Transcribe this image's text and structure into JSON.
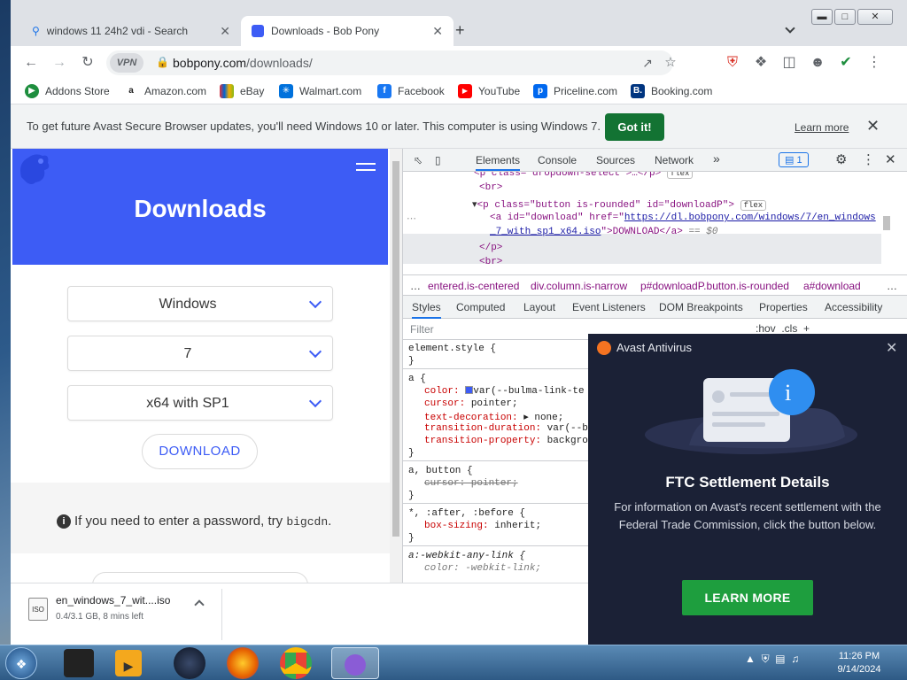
{
  "browser": {
    "tabs": [
      {
        "title": "windows 11 24h2 vdi - Search",
        "icon": "search-icon"
      },
      {
        "title": "Downloads - Bob Pony",
        "icon": "bobpony-favicon"
      }
    ],
    "new_tab_symbol": "+",
    "url_prefix": "bobpony.com",
    "url_path": "/downloads/",
    "vpn_label": "VPN",
    "bookmarks": [
      {
        "label": "Addons Store",
        "color": "#1e8e3e"
      },
      {
        "label": "Amazon.com",
        "color": "#222222"
      },
      {
        "label": "eBay",
        "color": "#e53238"
      },
      {
        "label": "Walmart.com",
        "color": "#0071dc"
      },
      {
        "label": "Facebook",
        "color": "#1877f2"
      },
      {
        "label": "YouTube",
        "color": "#ff0000"
      },
      {
        "label": "Priceline.com",
        "color": "#0068ef"
      },
      {
        "label": "Booking.com",
        "color": "#003580"
      }
    ]
  },
  "infobar": {
    "text": "To get future Avast Secure Browser updates, you'll need Windows 10 or later. This computer is using Windows 7.",
    "button": "Got it!",
    "link": "Learn more"
  },
  "page": {
    "title": "Downloads",
    "os_select": "Windows",
    "version_select": "7",
    "edition_select": "x64 with SP1",
    "download_button": "DOWNLOAD",
    "password_note": "If you need to enter a password, try",
    "password_code": "bigcdn",
    "password_end": ".",
    "accent_color": "#3d5cf5"
  },
  "devtools": {
    "tabs": [
      "Elements",
      "Console",
      "Sources",
      "Network"
    ],
    "more_tabs": "»",
    "issues_count": "1",
    "dom_lines": {
      "l1": "<p class=\"dropdown-select\">…</p>",
      "l1_badge": "flex",
      "l2": "<br>",
      "l3_open": "<p class=\"button is-rounded\" id=\"downloadP\">",
      "l3_badge": "flex",
      "l4_pre": "<a id=\"download\" href=\"",
      "l4_link": "https://dl.bobpony.com/windows/7/en_windows",
      "l5_link": "_7_with_sp1_x64.iso",
      "l5_post": "\">DOWNLOAD</a>",
      "l5_eq": "== $0",
      "l6": "</p>",
      "l7": "<br>"
    },
    "crumbs": [
      "entered.is-centered",
      "div.column.is-narrow",
      "p#downloadP.button.is-rounded",
      "a#download"
    ],
    "crumbs_prefix": "…",
    "crumbs_suffix": "…",
    "style_tabs": [
      "Styles",
      "Computed",
      "Layout",
      "Event Listeners",
      "DOM Breakpoints",
      "Properties",
      "Accessibility"
    ],
    "filter_placeholder": "Filter",
    "filter_tools": ":hov  .cls  +",
    "css_lines": {
      "c1": "element.style {",
      "c2": "}",
      "c3": "a {",
      "c4_name": "color:",
      "c4_val": "var(--bulma-link-te",
      "c5_name": "cursor:",
      "c5_val": "pointer;",
      "c6_name": "text-decoration:",
      "c6_val": "▸ none;",
      "c7_name": "transition-duration:",
      "c7_val": "var(--b",
      "c8_name": "transition-property:",
      "c8_val": "backgro",
      "c9": "}",
      "c10": "a, button {",
      "c11": "cursor: pointer;",
      "c12": "}",
      "c13": "*, :after, :before {",
      "c14_name": "box-sizing:",
      "c14_val": "inherit;",
      "c15": "}",
      "c16": "a:-webkit-any-link {",
      "c17": "color: -webkit-link;"
    }
  },
  "download": {
    "filename": "en_windows_7_wit....iso",
    "status": "0.4/3.1 GB, 8 mins left",
    "icon_text": "ISO"
  },
  "avast": {
    "brand": "Avast Antivirus",
    "heading": "FTC Settlement Details",
    "body": "For information on Avast's recent settlement with the Federal Trade Commission, click the button below.",
    "button": "LEARN MORE",
    "info_glyph": "i"
  },
  "taskbar": {
    "time": "11:26 PM",
    "date": "9/14/2024"
  }
}
